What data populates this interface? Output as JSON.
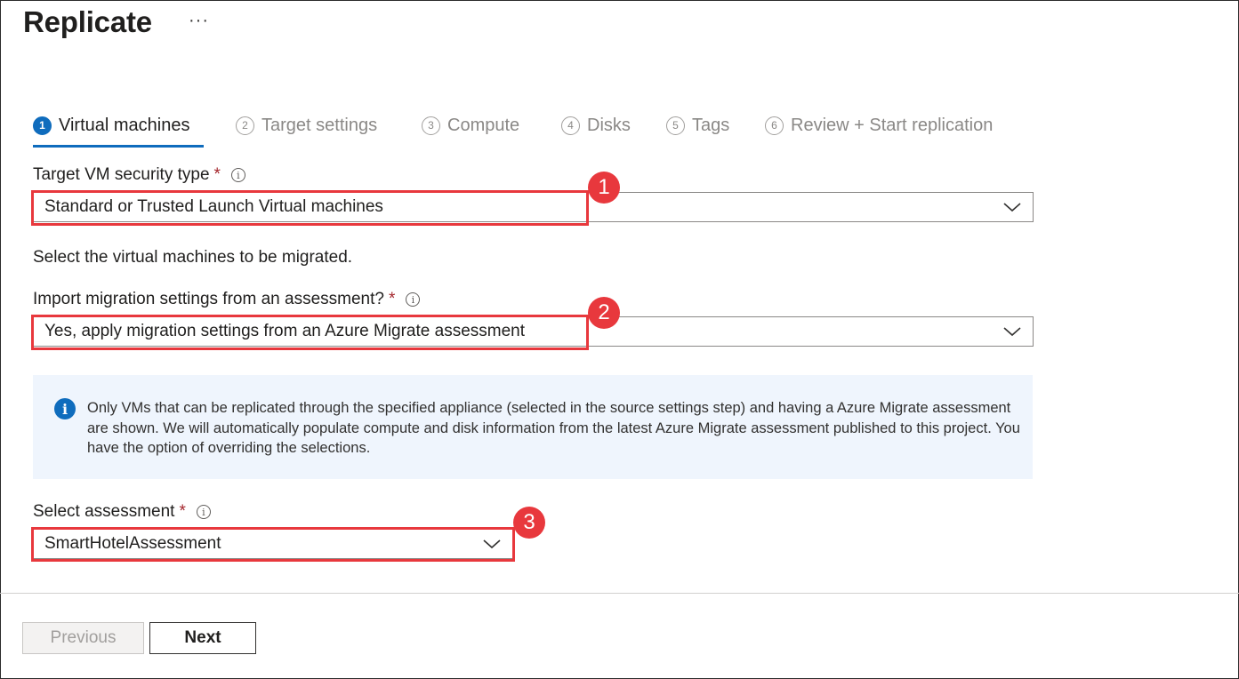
{
  "header": {
    "title": "Replicate",
    "more_label": "···"
  },
  "tabs": [
    {
      "num": "1",
      "label": "Virtual machines",
      "active": true
    },
    {
      "num": "2",
      "label": "Target settings"
    },
    {
      "num": "3",
      "label": "Compute"
    },
    {
      "num": "4",
      "label": "Disks"
    },
    {
      "num": "5",
      "label": "Tags"
    },
    {
      "num": "6",
      "label": "Review + Start replication"
    }
  ],
  "form": {
    "security_type": {
      "label": "Target VM security type",
      "required": "*",
      "value": "Standard or Trusted Launch Virtual machines"
    },
    "select_vms_text": "Select the virtual machines to be migrated.",
    "import_settings": {
      "label": "Import migration settings from an assessment?",
      "required": "*",
      "value": "Yes, apply migration settings from an Azure Migrate assessment"
    },
    "info_message": "Only VMs that can be replicated through the specified appliance (selected  in the source settings step) and having a Azure Migrate assessment are shown. We will automatically populate compute and disk information from the latest Azure Migrate assessment published to this project. You have the option of overriding the selections.",
    "assessment": {
      "label": "Select assessment",
      "required": "*",
      "value": "SmartHotelAssessment"
    }
  },
  "annotations": [
    "1",
    "2",
    "3"
  ],
  "footer": {
    "previous_label": "Previous",
    "next_label": "Next"
  },
  "icons": {
    "info": "info-icon",
    "chevron": "chevron-down-icon",
    "more": "more-icon"
  },
  "colors": {
    "accent": "#0f6cbd",
    "highlight": "#e8383d",
    "required": "#a4262c",
    "info_bg": "#eff5fd"
  }
}
